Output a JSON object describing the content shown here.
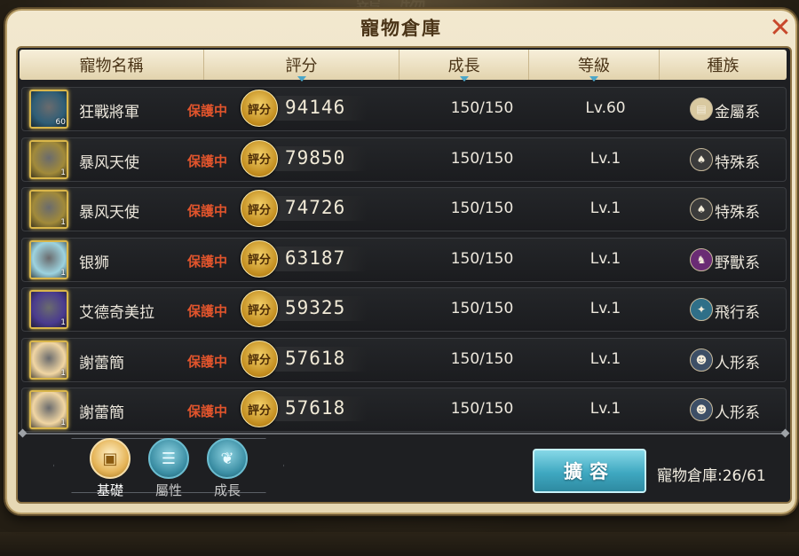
{
  "window": {
    "title": "寵物倉庫",
    "bg_heading": "寵物",
    "bg_bottom": ""
  },
  "columns": {
    "name": "寵物名稱",
    "score": "評分",
    "growth": "成長",
    "level": "等級",
    "race": "種族"
  },
  "protected_label": "保護中",
  "score_badge": "評分",
  "pets": [
    {
      "name": "狂戰將軍",
      "badge": "60",
      "score": "94146",
      "growth": "150/150",
      "level": "Lv.60",
      "race": "金屬系",
      "race_icon": "metal-icon",
      "avatar_color": "#2f5e77"
    },
    {
      "name": "暴风天使",
      "badge": "1",
      "score": "79850",
      "growth": "150/150",
      "level": "Lv.1",
      "race": "特殊系",
      "race_icon": "special-icon",
      "avatar_color": "#a18a3a"
    },
    {
      "name": "暴风天使",
      "badge": "1",
      "score": "74726",
      "growth": "150/150",
      "level": "Lv.1",
      "race": "特殊系",
      "race_icon": "special-icon",
      "avatar_color": "#a18a3a"
    },
    {
      "name": "银狮",
      "badge": "1",
      "score": "63187",
      "growth": "150/150",
      "level": "Lv.1",
      "race": "野獸系",
      "race_icon": "beast-icon",
      "avatar_color": "#9dd3df"
    },
    {
      "name": "艾德奇美拉",
      "badge": "1",
      "score": "59325",
      "growth": "150/150",
      "level": "Lv.1",
      "race": "飛行系",
      "race_icon": "flying-icon",
      "avatar_color": "#4a3b8f"
    },
    {
      "name": "謝蕾簡",
      "badge": "1",
      "score": "57618",
      "growth": "150/150",
      "level": "Lv.1",
      "race": "人形系",
      "race_icon": "humanoid-icon",
      "avatar_color": "#f1d6a3"
    },
    {
      "name": "謝蕾簡",
      "badge": "1",
      "score": "57618",
      "growth": "150/150",
      "level": "Lv.1",
      "race": "人形系",
      "race_icon": "humanoid-icon",
      "avatar_color": "#f1d6a3"
    }
  ],
  "tabs": [
    {
      "label": "基礎",
      "icon": "box-icon",
      "active": true
    },
    {
      "label": "屬性",
      "icon": "list-icon",
      "active": false
    },
    {
      "label": "成長",
      "icon": "leaf-icon",
      "active": false
    }
  ],
  "expand_label": "擴容",
  "capacity_text": "寵物倉庫:26/61"
}
